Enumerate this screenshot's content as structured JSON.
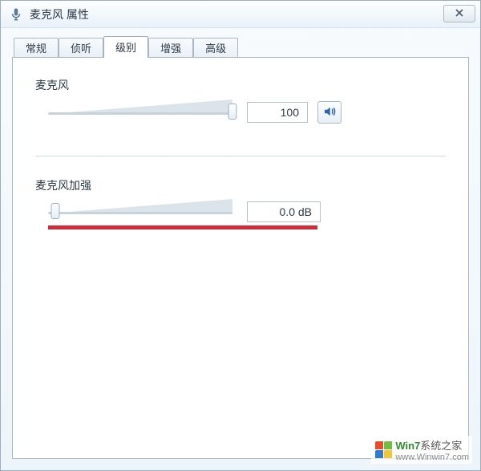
{
  "window": {
    "title": "麦克风 属性"
  },
  "tabs": [
    {
      "label": "常规",
      "active": false
    },
    {
      "label": "侦听",
      "active": false
    },
    {
      "label": "级别",
      "active": true
    },
    {
      "label": "增强",
      "active": false
    },
    {
      "label": "高级",
      "active": false
    }
  ],
  "mic_level": {
    "label": "麦克风",
    "value": "100",
    "slider_position_pct": 100
  },
  "mic_boost": {
    "label": "麦克风加强",
    "value": "0.0 dB",
    "slider_position_pct": 4
  },
  "watermark": {
    "brand_prefix": "Win7",
    "brand_suffix": "系统之家",
    "url": "www.Winwin7.com"
  }
}
